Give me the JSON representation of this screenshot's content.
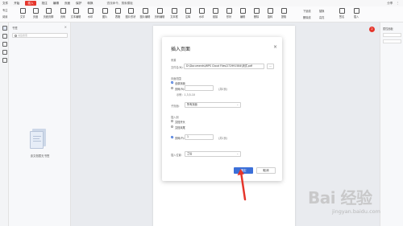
{
  "menubar": {
    "items": [
      "文件",
      "开始",
      "插入",
      "批注",
      "编辑",
      "页面",
      "保护",
      "转换"
    ],
    "active": "插入",
    "search": "查找命令、搜索模板",
    "right": [
      "分享",
      "⋮"
    ]
  },
  "toolbar": {
    "left_mini": [
      "专注",
      "阅读"
    ],
    "tools": [
      "文字",
      "页眉",
      "页眉页脚",
      "页码",
      "文本编辑",
      "水印",
      "图片",
      "表格",
      "图片形状",
      "图片编辑",
      "页码编辑",
      "文本框",
      "注释",
      "水印",
      "链接",
      "形状",
      "编辑",
      "删除",
      "旋转",
      "提取"
    ],
    "right_mini": [
      "下划线",
      "删除线",
      "替换",
      "高亮",
      "签名",
      "插入"
    ]
  },
  "left_panel": {
    "title": "书签",
    "search_placeholder": "书签搜索",
    "empty_text": "该文档暂无书签"
  },
  "right_panel": {
    "title": "属性面板",
    "fields": [
      "",
      ""
    ]
  },
  "badge": "2",
  "dialog": {
    "title": "插入页面",
    "source_label": "来源",
    "file_label": "文件名(N):",
    "file_value": "D:\\Documents\\WPS Cloud Files\\272991584\\测试.pdf",
    "browse": "...",
    "range_label": "页面范围",
    "all_pages": "全部页面",
    "page_range": "页码(R):",
    "page_range_hint": "(共0页)",
    "page_range_example": "示例：1,3,5-10",
    "sub_label": "子页面:",
    "sub_value": "所有页面",
    "insert_label": "插入到",
    "first_page": "文档开头",
    "last_page": "文档末尾",
    "page_label": "页码(P):",
    "page_value": "1",
    "page_hint": "(共1页)",
    "position_label": "插入位置:",
    "position_value": "之后",
    "ok": "确定",
    "cancel": "取消"
  },
  "watermark": {
    "big": "Bai 经验",
    "small": "jingyan.baidu.com"
  }
}
